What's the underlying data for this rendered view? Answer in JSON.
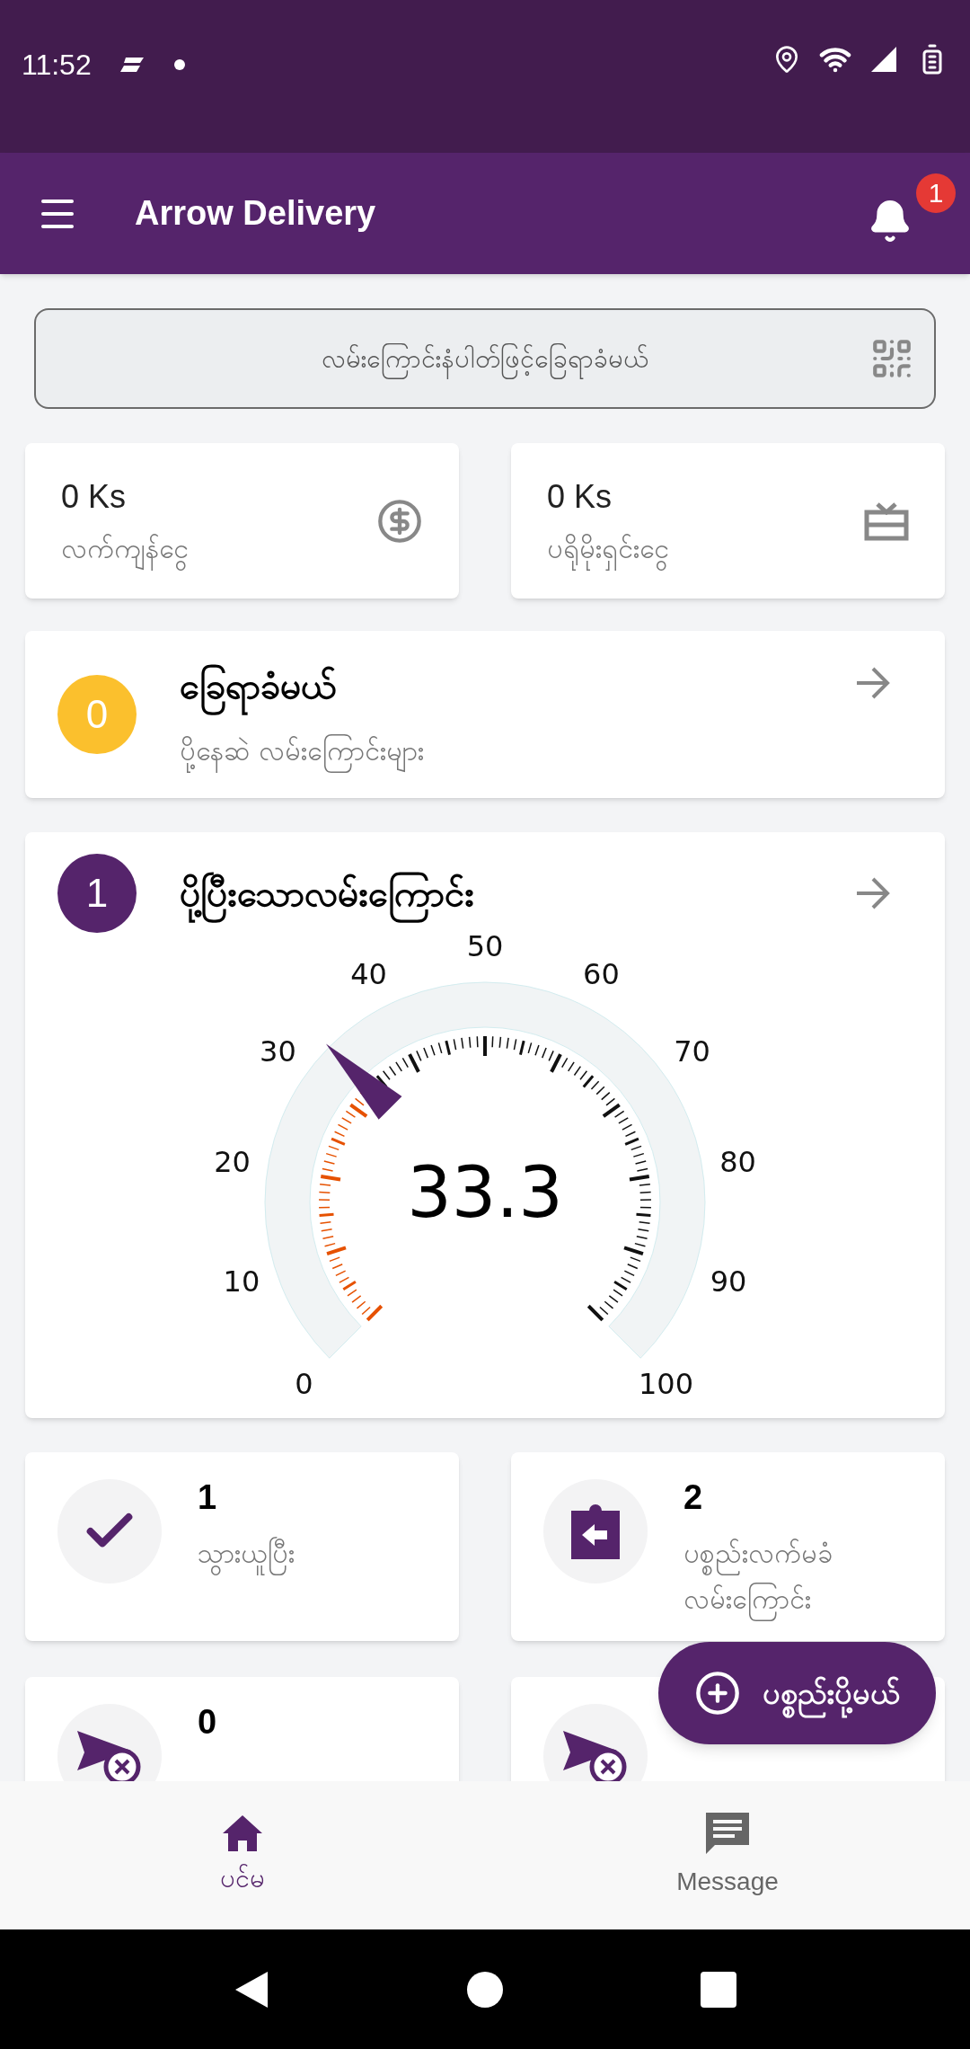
{
  "status_bar": {
    "time": "11:52"
  },
  "app_bar": {
    "title": "Arrow Delivery",
    "notification_count": "1"
  },
  "search": {
    "placeholder": "လမ်းကြောင်းနံပါတ်ဖြင့်ခြေရာခံမယ်"
  },
  "balances": [
    {
      "kind": "money",
      "amount": "0 Ks",
      "label": "လက်ကျန်ငွေ"
    },
    {
      "kind": "promo",
      "amount": "0 Ks",
      "label": "ပရိုမိုးရှင်းငွေ"
    }
  ],
  "tracking_card": {
    "count": "0",
    "title": "ခြေရာခံမယ်",
    "subtitle": "ပို့နေဆဲ လမ်းကြောင်းများ"
  },
  "delivered_card": {
    "count": "1",
    "title": "ပို့ပြီးသောလမ်းကြောင်း",
    "gauge": {
      "reading": "33.3",
      "tick_labels": [
        "0",
        "10",
        "20",
        "30",
        "40",
        "50",
        "60",
        "70",
        "80",
        "90",
        "100"
      ]
    }
  },
  "stats": [
    {
      "kind": "picked",
      "count": "1",
      "label": "သွားယူပြီး"
    },
    {
      "kind": "rejected",
      "count": "2",
      "label": "ပစ္စည်းလက်မခံ လမ်းကြောင်း"
    },
    {
      "kind": "cancelled",
      "count": "0"
    },
    {
      "kind": "cancelled"
    }
  ],
  "fab": {
    "label": "ပစ္စည်းပို့မယ်"
  },
  "bottom_nav": [
    {
      "kind": "home",
      "label": "ပင်မ",
      "selected": true
    },
    {
      "kind": "message",
      "label": "Message",
      "selected": false
    }
  ]
}
